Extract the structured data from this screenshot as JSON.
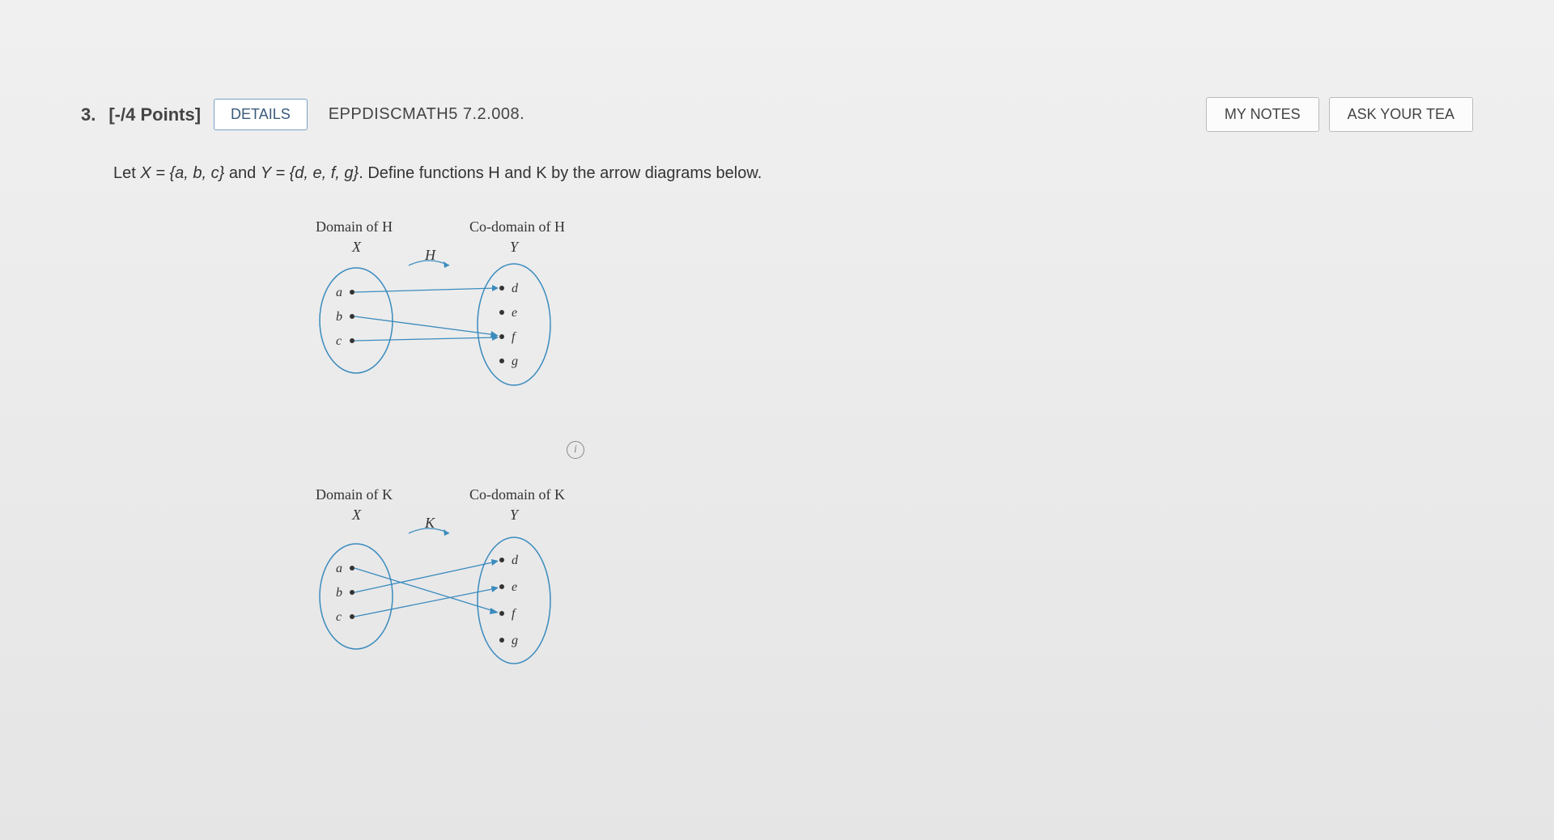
{
  "question": {
    "number": "3.",
    "points": "[-/4 Points]",
    "details_label": "DETAILS",
    "code": "EPPDISCMATH5 7.2.008.",
    "my_notes_label": "MY NOTES",
    "ask_teacher_label": "ASK YOUR TEA",
    "prompt_prefix": "Let ",
    "set_x": "X = {a, b, c}",
    "prompt_and": " and ",
    "set_y": "Y = {d, e, f, g}",
    "prompt_suffix": ". Define functions H and K by the arrow diagrams below."
  },
  "diagram_H": {
    "domain_label": "Domain of H",
    "codomain_label": "Co-domain of H",
    "domain_set": "X",
    "codomain_set": "Y",
    "func_name": "H",
    "domain_elements": [
      "a",
      "b",
      "c"
    ],
    "codomain_elements": [
      "d",
      "e",
      "f",
      "g"
    ],
    "mappings": [
      {
        "from": "a",
        "to": "d"
      },
      {
        "from": "b",
        "to": "f"
      },
      {
        "from": "c",
        "to": "f"
      }
    ]
  },
  "diagram_K": {
    "domain_label": "Domain of K",
    "codomain_label": "Co-domain of K",
    "domain_set": "X",
    "codomain_set": "Y",
    "func_name": "K",
    "domain_elements": [
      "a",
      "b",
      "c"
    ],
    "codomain_elements": [
      "d",
      "e",
      "f",
      "g"
    ],
    "mappings": [
      {
        "from": "a",
        "to": "f"
      },
      {
        "from": "b",
        "to": "d"
      },
      {
        "from": "c",
        "to": "e"
      }
    ]
  },
  "info_icon": "i"
}
